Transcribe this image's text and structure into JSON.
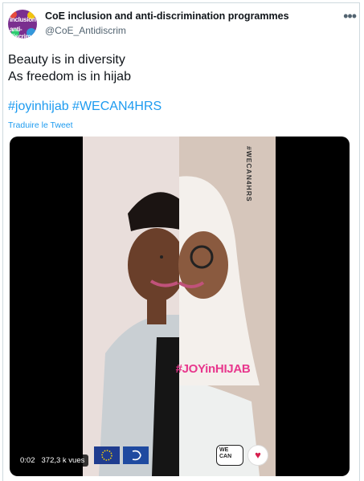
{
  "tweet": {
    "author_name": "CoE inclusion and anti-discrimination programmes",
    "author_handle": "@CoE_Antidiscrim",
    "avatar_text": [
      "inclusion",
      "anti-discrim"
    ],
    "body_lines": [
      "Beauty is in diversity",
      "As freedom is in hijab"
    ],
    "hashtags": "#joyinhijab #WECAN4HRS",
    "translate_label": "Traduire le Tweet",
    "more_icon": "ellipsis-icon"
  },
  "media": {
    "overlay_hashtag": "#JOYinHIJAB",
    "vertical_hashtag": "#WECAN4HRS",
    "time": "0:02",
    "views": "372,3 k vues",
    "wecan_logo_text": [
      "WE",
      "CAN"
    ]
  },
  "colors": {
    "link": "#1d9bf0",
    "overlay_pink": "#e8378d",
    "text": "#0f1419",
    "muted": "#536471"
  }
}
